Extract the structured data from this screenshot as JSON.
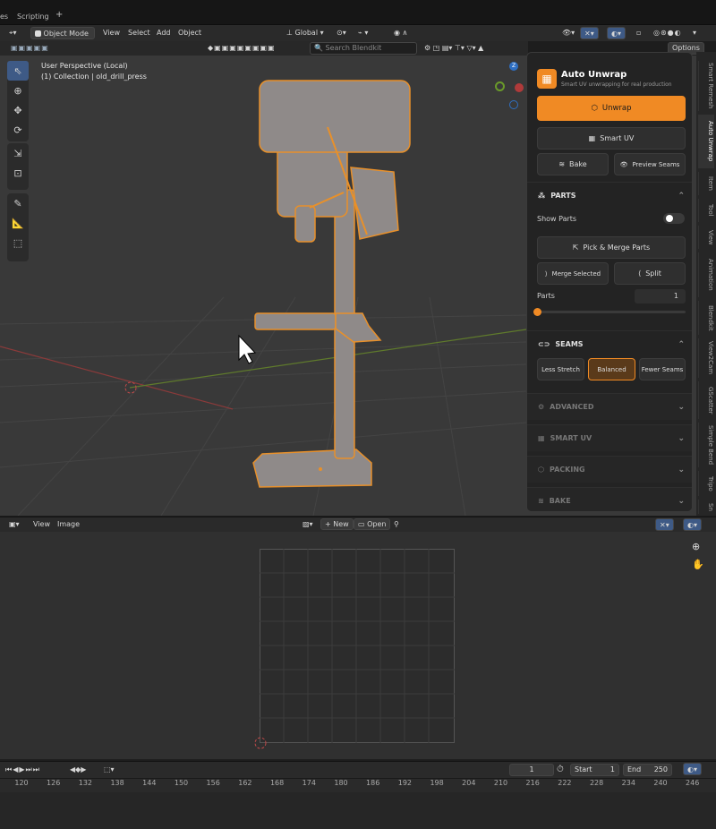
{
  "topbar": {
    "tab_partial": "es",
    "tab_scripting": "Scripting",
    "tab_add": "+"
  },
  "viewport_header": {
    "mode": "Object Mode",
    "menu_view": "View",
    "menu_select": "Select",
    "menu_add": "Add",
    "menu_object": "Object",
    "transform_orientation": "Global",
    "search_placeholder": "Search Blendkit",
    "options": "Options"
  },
  "viewport": {
    "perspective": "User Perspective (Local)",
    "collection": "(1) Collection | old_drill_press",
    "axes": {
      "z": "Z",
      "y": "Y",
      "x": "X"
    }
  },
  "sidebar_tabs": [
    "Smart Remesh",
    "Auto Unwrap",
    "Item",
    "Tool",
    "View",
    "Animation",
    "Blendkit",
    "View2Cam",
    "GScatter",
    "Simple Bend",
    "Tripo",
    "Sn"
  ],
  "panel": {
    "title": "Auto Unwrap",
    "subtitle": "Smart UV unwrapping for real production",
    "unwrap": "Unwrap",
    "smart_uv": "Smart UV",
    "bake": "Bake",
    "preview_seams": "Preview Seams",
    "parts_header": "PARTS",
    "show_parts": "Show Parts",
    "pick_merge": "Pick & Merge Parts",
    "merge_selected": "Merge Selected",
    "split": "Split",
    "parts_label": "Parts",
    "parts_value": "1",
    "parts_fraction": 0,
    "seams_header": "SEAMS",
    "less_stretch": "Less Stretch",
    "balanced": "Balanced",
    "fewer_seams": "Fewer Seams",
    "advanced": "ADVANCED",
    "smart_uv_section": "SMART UV",
    "packing": "PACKING",
    "bake_section": "BAKE"
  },
  "uv_header": {
    "menu_view": "View",
    "menu_image": "Image",
    "new": "New",
    "open": "Open"
  },
  "timeline": {
    "current_frame": "1",
    "start_label": "Start",
    "start_value": "1",
    "end_label": "End",
    "end_value": "250",
    "ticks": [
      "120",
      "126",
      "132",
      "138",
      "144",
      "150",
      "156",
      "162",
      "168",
      "174",
      "180",
      "186",
      "192",
      "198",
      "204",
      "210",
      "216",
      "222",
      "228",
      "234",
      "240",
      "246"
    ]
  },
  "colors": {
    "accent": "#f08a24",
    "selection": "#3e5a86",
    "outline": "#e8902a"
  }
}
